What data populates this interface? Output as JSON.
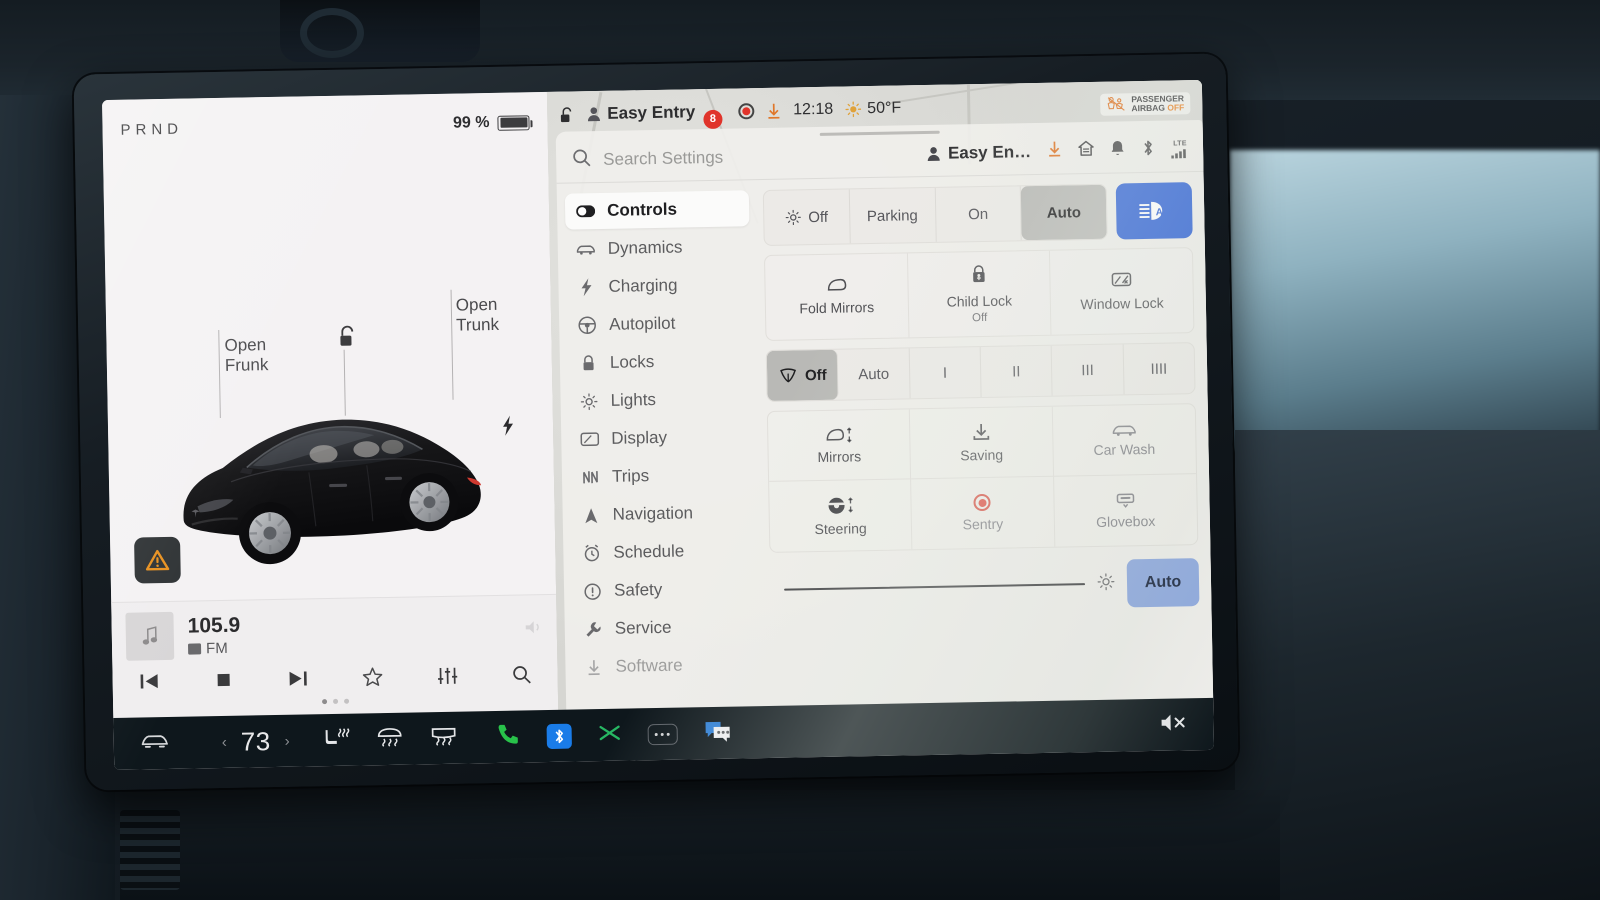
{
  "vehicle": {
    "gear_indicator": "PRND",
    "battery_percent": "99 %"
  },
  "status_bar": {
    "lock_icon": "unlocked-padlock-icon",
    "profile_icon": "person-icon",
    "profile_name": "Easy Entry",
    "notification_badge": "8",
    "sentry_recording_icon": "record-circle-icon",
    "download_icon": "download-arrow-icon",
    "time": "12:18",
    "weather_icon": "sun-icon",
    "temperature": "50°F",
    "airbag_line1": "PASSENGER",
    "airbag_line2": "AIRBAG",
    "airbag_state": "OFF"
  },
  "car_view": {
    "open_frunk_label": "Open\nFrunk",
    "open_frunk_line1": "Open",
    "open_frunk_line2": "Frunk",
    "open_trunk_line1": "Open",
    "open_trunk_line2": "Trunk",
    "unlock_icon": "unlock-icon",
    "charge_port_icon": "lightning-bolt-icon",
    "warning_icon": "warning-triangle-icon",
    "warning_color": "#e8911f",
    "car_color": "#151517"
  },
  "media_player": {
    "album_icon": "music-note-icon",
    "station": "105.9",
    "band": "FM",
    "controls": [
      {
        "name": "previous-track-button",
        "icon": "skip-back-icon"
      },
      {
        "name": "stop-button",
        "icon": "stop-square-icon"
      },
      {
        "name": "next-track-button",
        "icon": "skip-forward-icon"
      },
      {
        "name": "favorite-button",
        "icon": "star-outline-icon"
      },
      {
        "name": "equalizer-button",
        "icon": "sliders-icon"
      },
      {
        "name": "search-media-button",
        "icon": "magnifier-icon"
      }
    ],
    "page_dots": 3,
    "active_dot": 0
  },
  "settings": {
    "search": {
      "placeholder": "Search Settings",
      "icon": "magnifier-icon"
    },
    "profile_short": "Easy En…",
    "header_icons": [
      "download-arrow-icon",
      "home-icon",
      "bell-icon",
      "bluetooth-icon",
      "lte-signal-icon"
    ],
    "lte_label": "LTE",
    "nav_items": [
      {
        "label": "Controls",
        "icon": "toggle-switch-icon",
        "active": true
      },
      {
        "label": "Dynamics",
        "icon": "car-icon",
        "active": false
      },
      {
        "label": "Charging",
        "icon": "lightning-bolt-icon",
        "active": false
      },
      {
        "label": "Autopilot",
        "icon": "steering-wheel-icon",
        "active": false
      },
      {
        "label": "Locks",
        "icon": "padlock-icon",
        "active": false
      },
      {
        "label": "Lights",
        "icon": "sun-icon",
        "active": false
      },
      {
        "label": "Display",
        "icon": "screen-icon",
        "active": false
      },
      {
        "label": "Trips",
        "icon": "route-icon",
        "active": false
      },
      {
        "label": "Navigation",
        "icon": "navigation-arrow-icon",
        "active": false
      },
      {
        "label": "Schedule",
        "icon": "alarm-clock-icon",
        "active": false
      },
      {
        "label": "Safety",
        "icon": "exclamation-circle-icon",
        "active": false
      },
      {
        "label": "Service",
        "icon": "wrench-icon",
        "active": false
      },
      {
        "label": "Software",
        "icon": "download-arrow-icon",
        "active": false
      }
    ],
    "headlights": {
      "options": [
        {
          "label": "Off",
          "icon": "sun-rays-icon",
          "selected": false
        },
        {
          "label": "Parking",
          "icon": null,
          "selected": false
        },
        {
          "label": "On",
          "icon": null,
          "selected": false
        },
        {
          "label": "Auto",
          "icon": null,
          "selected": true
        }
      ],
      "auto_highbeam": {
        "name": "auto-high-beam-button",
        "icon": "auto-highbeam-icon",
        "color": "#2f62d6",
        "active": true
      }
    },
    "mirror_lock_tiles": [
      {
        "label": "Fold Mirrors",
        "sub": "",
        "icon": "mirror-icon"
      },
      {
        "label": "Child Lock",
        "sub": "Off",
        "icon": "child-lock-icon"
      },
      {
        "label": "Window Lock",
        "sub": "",
        "icon": "window-lock-icon"
      }
    ],
    "wipers": [
      {
        "label": "Off",
        "icon": "wiper-icon",
        "selected": true
      },
      {
        "label": "Auto",
        "icon": null,
        "selected": false
      },
      {
        "label": "I",
        "icon": null,
        "selected": false
      },
      {
        "label": "II",
        "icon": null,
        "selected": false
      },
      {
        "label": "III",
        "icon": null,
        "selected": false
      },
      {
        "label": "IIII",
        "icon": null,
        "selected": false
      }
    ],
    "quick_grid": [
      {
        "label": "Mirrors",
        "icon": "mirror-adjust-icon",
        "dim": false
      },
      {
        "label": "Saving",
        "icon": "download-arrow-icon",
        "dim": false
      },
      {
        "label": "Car Wash",
        "icon": "car-icon",
        "dim": true
      },
      {
        "label": "Steering",
        "icon": "steering-adjust-icon",
        "dim": false
      },
      {
        "label": "Sentry",
        "icon": "record-circle-icon",
        "dim": true
      },
      {
        "label": "Glovebox",
        "icon": "glovebox-icon",
        "dim": true
      }
    ],
    "brightness": {
      "slider_name": "brightness-slider",
      "icon": "brightness-sun-icon",
      "auto_label": "Auto",
      "auto_color": "#8ba6de",
      "value_percent": 86
    }
  },
  "taskbar": {
    "car_icon": "car-front-icon",
    "temp_prev_icon": "chevron-left-icon",
    "temperature": "73",
    "temp_next_icon": "chevron-right-icon",
    "climate_icons": [
      {
        "name": "seat-heater-icon"
      },
      {
        "name": "rear-defrost-icon"
      },
      {
        "name": "front-defrost-icon"
      }
    ],
    "apps": [
      {
        "name": "phone-icon",
        "color": "#28c24a"
      },
      {
        "name": "bluetooth-app-icon",
        "color": "#1a7ce8"
      },
      {
        "name": "shuffle-icon",
        "color": "#27b763"
      },
      {
        "name": "more-apps-icon",
        "color": "#d2d4d6"
      },
      {
        "name": "messages-icon",
        "color": "#2f7fd6"
      }
    ],
    "volume_icon": "volume-muted-icon"
  }
}
